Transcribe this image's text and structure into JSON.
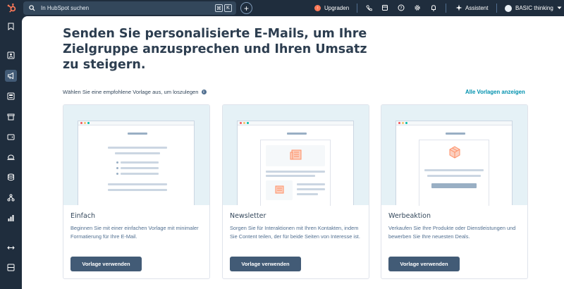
{
  "topbar": {
    "search_placeholder": "In HubSpot suchen",
    "kbd_1": "⌘",
    "kbd_2": "K",
    "plus": "+",
    "upgrade_label": "Upgraden",
    "assistant_label": "Assistent",
    "account_label": "BASIC thinking"
  },
  "main": {
    "headline": "Senden Sie personalisierte E-Mails, um Ihre Zielgruppe anzusprechen und Ihren Umsatz zu steigern.",
    "subline": "Wählen Sie eine empfohlene Vorlage aus, um loszulegen",
    "all_templates_link": "Alle Vorlagen anzeigen",
    "cards": [
      {
        "title": "Einfach",
        "description": "Beginnen Sie mit einer einfachen Vorlage mit minimaler Formatierung für Ihre E-Mail.",
        "button": "Vorlage verwenden"
      },
      {
        "title": "Newsletter",
        "description": "Sorgen Sie für Interaktionen mit Ihren Kontakten, indem Sie Content teilen, der für beide Seiten von Interesse ist.",
        "button": "Vorlage verwenden"
      },
      {
        "title": "Werbeaktion",
        "description": "Verkaufen Sie Ihre Produkte oder Dienstleistungen und bewerben Sie Ihre neuesten Deals.",
        "button": "Vorlage verwenden"
      }
    ]
  },
  "colors": {
    "topbar": "#1f2d3d",
    "accent_link": "#0091ae",
    "button": "#425b76",
    "preview_bg": "#e5f1f6",
    "brand_orange": "#ff7a59"
  }
}
